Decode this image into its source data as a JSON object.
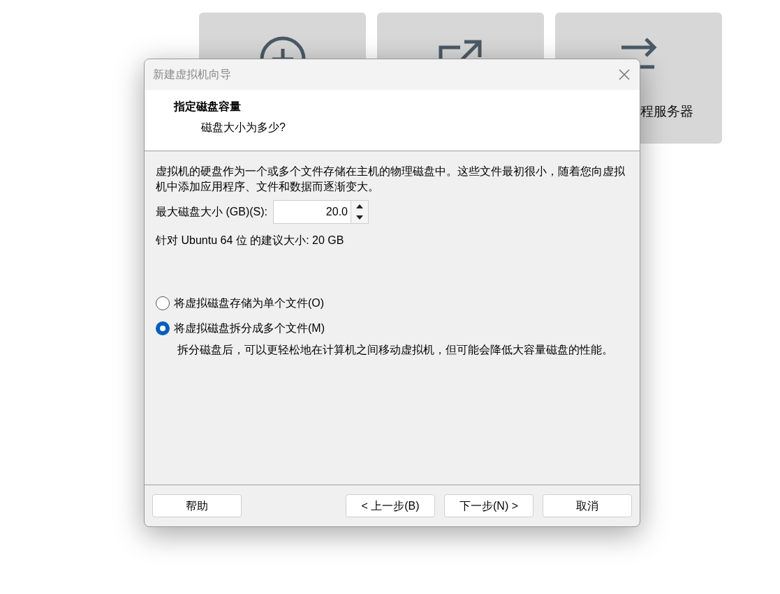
{
  "cards": [
    {
      "kind": "plus"
    },
    {
      "kind": "open"
    },
    {
      "kind": "transfer",
      "label": "程服务器"
    }
  ],
  "dialog": {
    "title": "新建虚拟机向导",
    "heading": "指定磁盘容量",
    "subheading": "磁盘大小为多少?",
    "intro": "虚拟机的硬盘作为一个或多个文件存储在主机的物理磁盘中。这些文件最初很小，随着您向虚拟机中添加应用程序、文件和数据而逐渐变大。",
    "size_label": "最大磁盘大小 (GB)(S):",
    "size_value": "20.0",
    "recommendation": "针对 Ubuntu 64 位 的建议大小: 20 GB",
    "options": [
      {
        "label": "将虚拟磁盘存储为单个文件(O)",
        "selected": false
      },
      {
        "label": "将虚拟磁盘拆分成多个文件(M)",
        "selected": true,
        "note": "拆分磁盘后，可以更轻松地在计算机之间移动虚拟机，但可能会降低大容量磁盘的性能。"
      }
    ],
    "buttons": {
      "help": "帮助",
      "back": "< 上一步(B)",
      "next": "下一步(N) >",
      "cancel": "取消"
    }
  }
}
